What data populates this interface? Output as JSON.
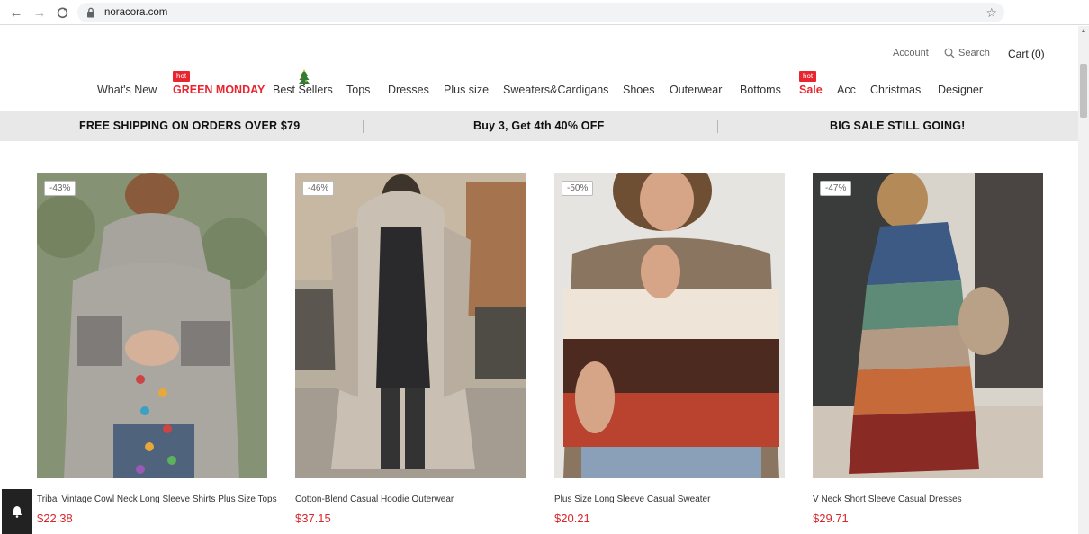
{
  "browser": {
    "url": "noracora.com"
  },
  "header": {
    "account_label": "Account",
    "search_label": "Search",
    "cart_label": "Cart (0)"
  },
  "nav": {
    "hot_badge": "hot",
    "items": [
      "What's New",
      "GREEN MONDAY",
      "Best Sellers",
      "Tops",
      "Dresses",
      "Plus size",
      "Sweaters&Cardigans",
      "Shoes",
      "Outerwear",
      "Bottoms",
      "Sale",
      "Acc",
      "Christmas",
      "Designer"
    ]
  },
  "promo": {
    "left": "FREE SHIPPING ON ORDERS OVER $79",
    "center": "Buy 3, Get 4th 40% OFF",
    "right": "BIG SALE STILL GOING!"
  },
  "products": [
    {
      "discount": "-43%",
      "title": "Tribal Vintage Cowl Neck Long Sleeve Shirts Plus Size Tops",
      "price": "$22.38"
    },
    {
      "discount": "-46%",
      "title": "Cotton-Blend Casual Hoodie Outerwear",
      "price": "$37.15"
    },
    {
      "discount": "-50%",
      "title": "Plus Size Long Sleeve Casual Sweater",
      "price": "$20.21"
    },
    {
      "discount": "-47%",
      "title": "V Neck Short Sleeve Casual Dresses",
      "price": "$29.71"
    }
  ],
  "colors": {
    "accent_red": "#e8262f",
    "price_red": "#d9272e",
    "promo_bg": "#e8e8e8"
  },
  "icons": {
    "back": "arrow-left-icon",
    "forward": "arrow-right-icon",
    "reload": "reload-icon",
    "lock": "lock-icon",
    "bookmark": "star-icon",
    "search": "magnifier-icon",
    "bell": "bell-icon",
    "tree": "christmas-tree-icon"
  }
}
